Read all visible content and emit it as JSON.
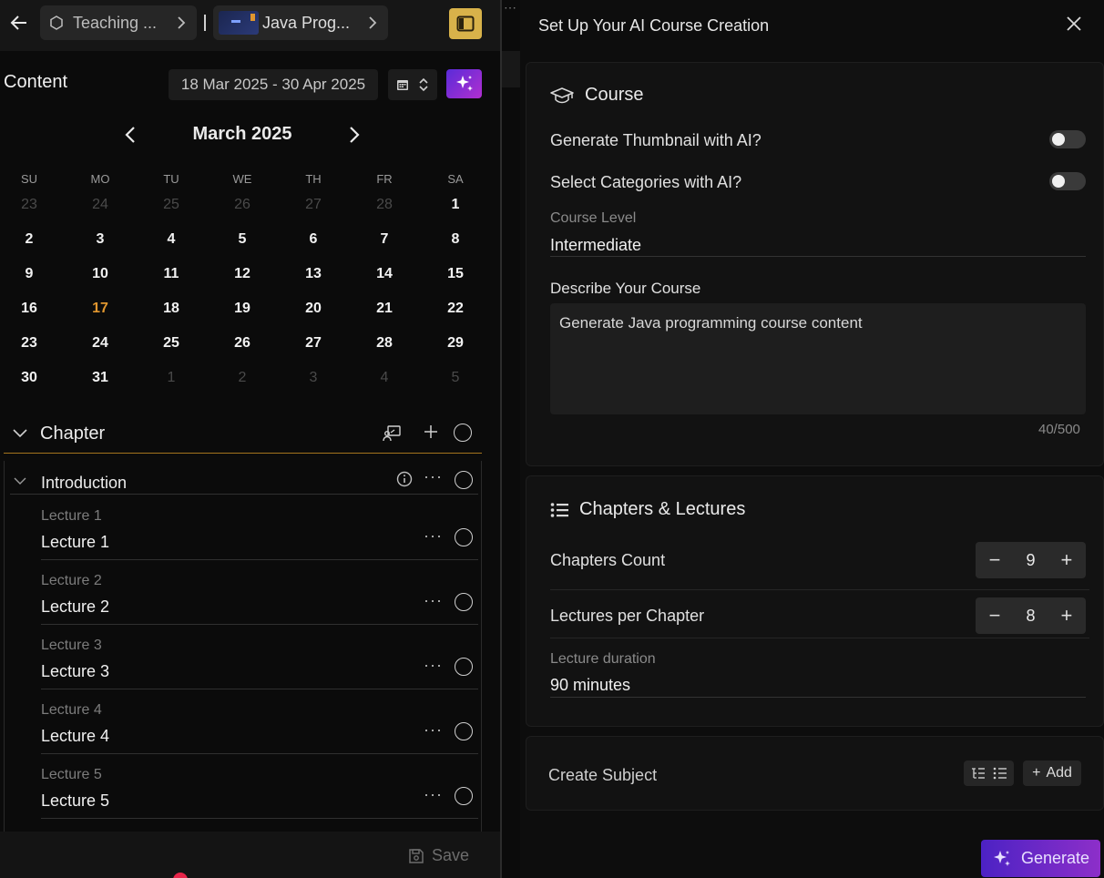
{
  "left": {
    "breadcrumb": [
      {
        "label": "Teaching ..."
      },
      {
        "label": "Java Prog..."
      }
    ],
    "content_title": "Content",
    "date_range": "18 Mar 2025 - 30 Apr 2025",
    "calendar": {
      "month_label": "March 2025",
      "weekdays": [
        "SU",
        "MO",
        "TU",
        "WE",
        "TH",
        "FR",
        "SA"
      ],
      "weeks": [
        [
          "23",
          "24",
          "25",
          "26",
          "27",
          "28",
          "1"
        ],
        [
          "2",
          "3",
          "4",
          "5",
          "6",
          "7",
          "8"
        ],
        [
          "9",
          "10",
          "11",
          "12",
          "13",
          "14",
          "15"
        ],
        [
          "16",
          "17",
          "18",
          "19",
          "20",
          "21",
          "22"
        ],
        [
          "23",
          "24",
          "25",
          "26",
          "27",
          "28",
          "29"
        ],
        [
          "30",
          "31",
          "1",
          "2",
          "3",
          "4",
          "5"
        ]
      ],
      "today": "17"
    },
    "chapter_label": "Chapter",
    "introduction_label": "Introduction",
    "lectures": [
      {
        "sub": "Lecture 1",
        "title": "Lecture 1"
      },
      {
        "sub": "Lecture 2",
        "title": "Lecture 2"
      },
      {
        "sub": "Lecture 3",
        "title": "Lecture 3"
      },
      {
        "sub": "Lecture 4",
        "title": "Lecture 4"
      },
      {
        "sub": "Lecture 5",
        "title": "Lecture 5"
      }
    ],
    "save_label": "Save"
  },
  "right": {
    "title": "Set Up Your AI Course Creation",
    "course": {
      "section_title": "Course",
      "thumbnail_label": "Generate Thumbnail with AI?",
      "thumbnail_on": false,
      "categories_label": "Select Categories with AI?",
      "categories_on": false,
      "level_label": "Course Level",
      "level_value": "Intermediate",
      "describe_label": "Describe Your Course",
      "describe_value": "Generate Java programming course content",
      "counter": "40/500"
    },
    "chapters": {
      "section_title": "Chapters & Lectures",
      "chapters_count_label": "Chapters Count",
      "chapters_count": "9",
      "lectures_label": "Lectures per Chapter",
      "lectures_count": "8",
      "duration_label": "Lecture duration",
      "duration_value": "90 minutes"
    },
    "subject": {
      "label": "Create Subject",
      "add_label": "Add"
    },
    "generate_label": "Generate"
  },
  "colors": {
    "accent_gold": "#e0962f",
    "ai_gradient_start": "#5a2bd8",
    "ai_gradient_end": "#b12fd0",
    "chapter_underline": "#a4741e"
  }
}
